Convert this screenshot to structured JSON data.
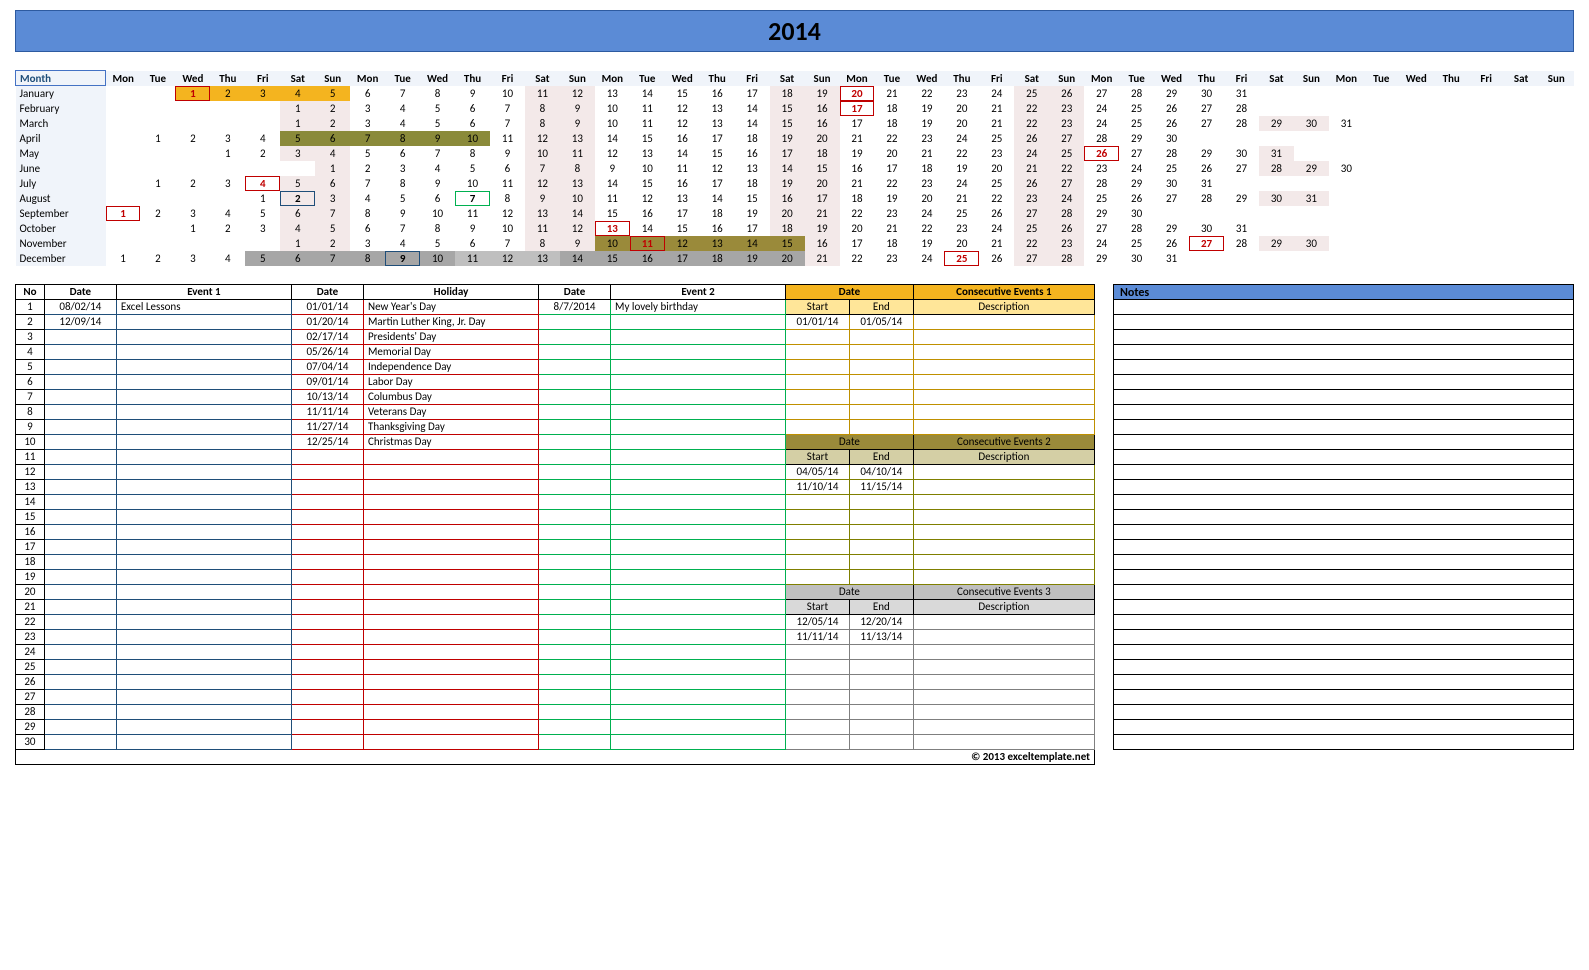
{
  "year": "2014",
  "dow": [
    "Mon",
    "Tue",
    "Wed",
    "Thu",
    "Fri",
    "Sat",
    "Sun"
  ],
  "months": [
    {
      "name": "January",
      "offset": 2,
      "days": 31,
      "y": [
        1,
        2,
        3,
        4,
        5
      ],
      "r": [
        1,
        20
      ]
    },
    {
      "name": "February",
      "offset": 5,
      "days": 28,
      "r": [
        17
      ]
    },
    {
      "name": "March",
      "offset": 5,
      "days": 31
    },
    {
      "name": "April",
      "offset": 1,
      "days": 30,
      "o": [
        5,
        6,
        7,
        8,
        9,
        10
      ]
    },
    {
      "name": "May",
      "offset": 3,
      "days": 31,
      "r": [
        26
      ]
    },
    {
      "name": "June",
      "offset": 6,
      "days": 30
    },
    {
      "name": "July",
      "offset": 1,
      "days": 31,
      "r": [
        4
      ]
    },
    {
      "name": "August",
      "offset": 4,
      "days": 31,
      "b": [
        2
      ],
      "gr": [
        7
      ]
    },
    {
      "name": "September",
      "offset": 0,
      "days": 30,
      "r": [
        1
      ]
    },
    {
      "name": "October",
      "offset": 2,
      "days": 31,
      "r": [
        13
      ]
    },
    {
      "name": "November",
      "offset": 5,
      "days": 30,
      "r": [
        11,
        27
      ],
      "do": [
        10,
        11,
        12,
        13,
        14,
        15
      ]
    },
    {
      "name": "December",
      "offset": 0,
      "days": 31,
      "b": [
        9
      ],
      "r": [
        25
      ],
      "g": [
        5,
        6,
        7,
        8,
        9,
        10,
        11,
        12,
        13,
        14,
        15,
        16,
        17,
        18,
        19,
        20
      ],
      "lg": [
        11,
        12,
        13
      ]
    }
  ],
  "event1_hdr": {
    "no": "No",
    "date": "Date",
    "name": "Event 1"
  },
  "event1": [
    {
      "no": "1",
      "date": "08/02/14",
      "name": "Excel Lessons"
    },
    {
      "no": "2",
      "date": "12/09/14",
      "name": ""
    }
  ],
  "holiday_hdr": {
    "date": "Date",
    "name": "Holiday"
  },
  "holidays": [
    {
      "date": "01/01/14",
      "name": "New Year's Day"
    },
    {
      "date": "01/20/14",
      "name": "Martin Luther King, Jr. Day"
    },
    {
      "date": "02/17/14",
      "name": "Presidents' Day"
    },
    {
      "date": "05/26/14",
      "name": "Memorial Day"
    },
    {
      "date": "07/04/14",
      "name": "Independence Day"
    },
    {
      "date": "09/01/14",
      "name": "Labor Day"
    },
    {
      "date": "10/13/14",
      "name": "Columbus Day"
    },
    {
      "date": "11/11/14",
      "name": "Veterans Day"
    },
    {
      "date": "11/27/14",
      "name": "Thanksgiving Day"
    },
    {
      "date": "12/25/14",
      "name": "Christmas Day"
    }
  ],
  "event2_hdr": {
    "date": "Date",
    "name": "Event 2"
  },
  "event2": [
    {
      "date": "8/7/2014",
      "name": "My lovely birthday"
    }
  ],
  "ce1": {
    "title": "Consecutive Events 1",
    "date": "Date",
    "start": "Start",
    "end": "End",
    "desc": "Description",
    "rows": [
      {
        "start": "01/01/14",
        "end": "01/05/14",
        "desc": ""
      }
    ]
  },
  "ce2": {
    "title": "Consecutive Events 2",
    "date": "Date",
    "start": "Start",
    "end": "End",
    "desc": "Description",
    "rows": [
      {
        "start": "04/05/14",
        "end": "04/10/14",
        "desc": ""
      },
      {
        "start": "11/10/14",
        "end": "11/15/14",
        "desc": ""
      }
    ]
  },
  "ce3": {
    "title": "Consecutive Events 3",
    "date": "Date",
    "start": "Start",
    "end": "End",
    "desc": "Description",
    "rows": [
      {
        "start": "12/05/14",
        "end": "12/20/14",
        "desc": ""
      },
      {
        "start": "11/11/14",
        "end": "11/13/14",
        "desc": ""
      }
    ]
  },
  "notes_hdr": "Notes",
  "copyright": "© 2013 exceltemplate.net",
  "max_rows": 30,
  "notes_rows": 30
}
